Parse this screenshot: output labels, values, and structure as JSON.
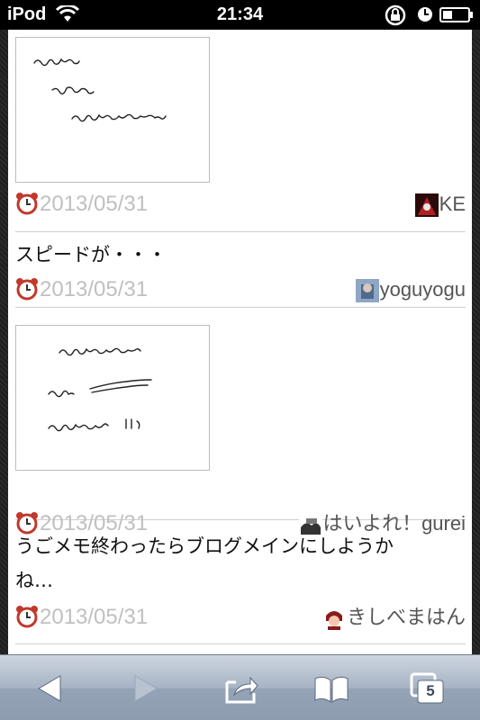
{
  "status_bar": {
    "carrier": "iPod",
    "time": "21:34"
  },
  "posts": [
    {
      "type": "drawing",
      "date": "2013/05/31",
      "user": "KE",
      "drawing_icon": "handwritten-sketch"
    },
    {
      "type": "text",
      "text": "スピードが・・・",
      "date": "2013/05/31",
      "user": "yoguyogu"
    },
    {
      "type": "drawing",
      "date": "2013/05/31",
      "user": "はいよれ！gurei",
      "drawing_icon": "handwritten-sketch"
    },
    {
      "type": "text",
      "text_line1": "うごメモ終わったらブログメインにしようか",
      "text_line2": "ね…",
      "date": "2013/05/31",
      "user": "きしべまはん"
    }
  ],
  "toolbar": {
    "tabs_count": "5",
    "icons": [
      "back-icon",
      "forward-icon",
      "share-icon",
      "bookmarks-icon",
      "tabs-icon"
    ]
  },
  "colors": {
    "date_text": "#c0c0c0",
    "alarm_icon": "#c0392b",
    "toolbar": "#a7b3c4"
  }
}
